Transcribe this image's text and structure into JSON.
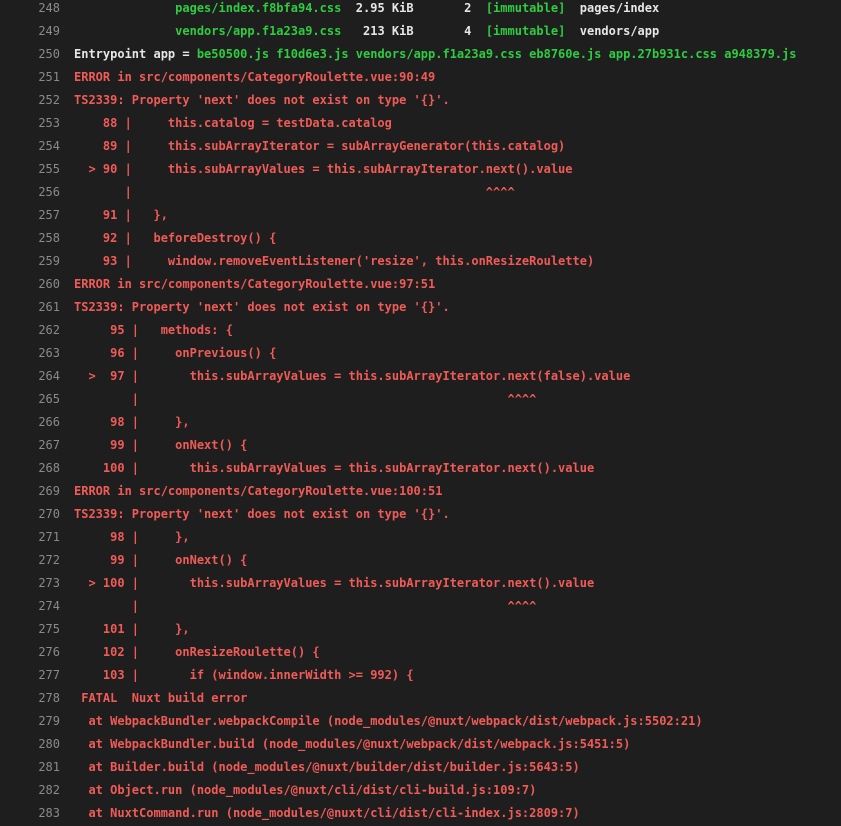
{
  "lines": [
    {
      "no": "248",
      "segs": [
        {
          "t": "              ",
          "c": "white"
        },
        {
          "t": "pages/index.f8bfa94.css",
          "c": "green"
        },
        {
          "t": "  2.95 KiB       2  ",
          "c": "white"
        },
        {
          "t": "[immutable]",
          "c": "green"
        },
        {
          "t": "  pages/index",
          "c": "white"
        }
      ]
    },
    {
      "no": "249",
      "segs": [
        {
          "t": "              ",
          "c": "white"
        },
        {
          "t": "vendors/app.f1a23a9.css",
          "c": "green"
        },
        {
          "t": "   213 KiB       4  ",
          "c": "white"
        },
        {
          "t": "[immutable]",
          "c": "green"
        },
        {
          "t": "  vendors/app",
          "c": "white"
        }
      ]
    },
    {
      "no": "250",
      "segs": [
        {
          "t": "Entrypoint app = ",
          "c": "white"
        },
        {
          "t": "be50500.js f10d6e3.js vendors/app.f1a23a9.css eb8760e.js app.27b931c.css a948379.js",
          "c": "green"
        }
      ]
    },
    {
      "no": "251",
      "segs": [
        {
          "t": "ERROR in src/components/CategoryRoulette.vue:90:49",
          "c": "red"
        }
      ]
    },
    {
      "no": "252",
      "segs": [
        {
          "t": "TS2339: Property 'next' does not exist on type '{}'.",
          "c": "red"
        }
      ]
    },
    {
      "no": "253",
      "segs": [
        {
          "t": "    88 |     this.catalog = testData.catalog",
          "c": "red"
        }
      ]
    },
    {
      "no": "254",
      "segs": [
        {
          "t": "    89 |     this.subArrayIterator = subArrayGenerator(this.catalog)",
          "c": "red"
        }
      ]
    },
    {
      "no": "255",
      "segs": [
        {
          "t": "  > 90 |     this.subArrayValues = this.subArrayIterator.next().value",
          "c": "red"
        }
      ]
    },
    {
      "no": "256",
      "segs": [
        {
          "t": "       |                                                 ^^^^",
          "c": "red"
        }
      ]
    },
    {
      "no": "257",
      "segs": [
        {
          "t": "    91 |   },",
          "c": "red"
        }
      ]
    },
    {
      "no": "258",
      "segs": [
        {
          "t": "    92 |   beforeDestroy() {",
          "c": "red"
        }
      ]
    },
    {
      "no": "259",
      "segs": [
        {
          "t": "    93 |     window.removeEventListener('resize', this.onResizeRoulette)",
          "c": "red"
        }
      ]
    },
    {
      "no": "260",
      "segs": [
        {
          "t": "ERROR in src/components/CategoryRoulette.vue:97:51",
          "c": "red"
        }
      ]
    },
    {
      "no": "261",
      "segs": [
        {
          "t": "TS2339: Property 'next' does not exist on type '{}'.",
          "c": "red"
        }
      ]
    },
    {
      "no": "262",
      "segs": [
        {
          "t": "     95 |   methods: {",
          "c": "red"
        }
      ]
    },
    {
      "no": "263",
      "segs": [
        {
          "t": "     96 |     onPrevious() {",
          "c": "red"
        }
      ]
    },
    {
      "no": "264",
      "segs": [
        {
          "t": "  >  97 |       this.subArrayValues = this.subArrayIterator.next(false).value",
          "c": "red"
        }
      ]
    },
    {
      "no": "265",
      "segs": [
        {
          "t": "        |                                                   ^^^^",
          "c": "red"
        }
      ]
    },
    {
      "no": "266",
      "segs": [
        {
          "t": "     98 |     },",
          "c": "red"
        }
      ]
    },
    {
      "no": "267",
      "segs": [
        {
          "t": "     99 |     onNext() {",
          "c": "red"
        }
      ]
    },
    {
      "no": "268",
      "segs": [
        {
          "t": "    100 |       this.subArrayValues = this.subArrayIterator.next().value",
          "c": "red"
        }
      ]
    },
    {
      "no": "269",
      "segs": [
        {
          "t": "ERROR in src/components/CategoryRoulette.vue:100:51",
          "c": "red"
        }
      ]
    },
    {
      "no": "270",
      "segs": [
        {
          "t": "TS2339: Property 'next' does not exist on type '{}'.",
          "c": "red"
        }
      ]
    },
    {
      "no": "271",
      "segs": [
        {
          "t": "     98 |     },",
          "c": "red"
        }
      ]
    },
    {
      "no": "272",
      "segs": [
        {
          "t": "     99 |     onNext() {",
          "c": "red"
        }
      ]
    },
    {
      "no": "273",
      "segs": [
        {
          "t": "  > 100 |       this.subArrayValues = this.subArrayIterator.next().value",
          "c": "red"
        }
      ]
    },
    {
      "no": "274",
      "segs": [
        {
          "t": "        |                                                   ^^^^",
          "c": "red"
        }
      ]
    },
    {
      "no": "275",
      "segs": [
        {
          "t": "    101 |     },",
          "c": "red"
        }
      ]
    },
    {
      "no": "276",
      "segs": [
        {
          "t": "    102 |     onResizeRoulette() {",
          "c": "red"
        }
      ]
    },
    {
      "no": "277",
      "segs": [
        {
          "t": "    103 |       if (window.innerWidth >= 992) {",
          "c": "red"
        }
      ]
    },
    {
      "no": "278",
      "segs": [
        {
          "t": " FATAL  Nuxt build error",
          "c": "red"
        }
      ]
    },
    {
      "no": "279",
      "segs": [
        {
          "t": "  at WebpackBundler.webpackCompile (node_modules/@nuxt/webpack/dist/webpack.js:5502:21)",
          "c": "red"
        }
      ]
    },
    {
      "no": "280",
      "segs": [
        {
          "t": "  at WebpackBundler.build (node_modules/@nuxt/webpack/dist/webpack.js:5451:5)",
          "c": "red"
        }
      ]
    },
    {
      "no": "281",
      "segs": [
        {
          "t": "  at Builder.build (node_modules/@nuxt/builder/dist/builder.js:5643:5)",
          "c": "red"
        }
      ]
    },
    {
      "no": "282",
      "segs": [
        {
          "t": "  at Object.run (node_modules/@nuxt/cli/dist/cli-build.js:109:7)",
          "c": "red"
        }
      ]
    },
    {
      "no": "283",
      "segs": [
        {
          "t": "  at NuxtCommand.run (node_modules/@nuxt/cli/dist/cli-index.js:2809:7)",
          "c": "red"
        }
      ]
    }
  ]
}
